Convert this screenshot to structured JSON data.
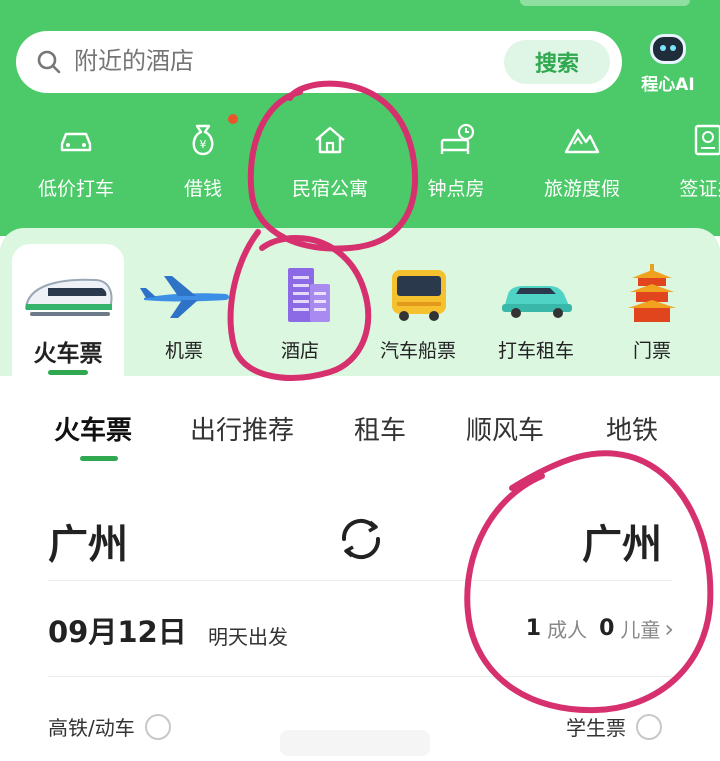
{
  "search": {
    "placeholder": "附近的酒店",
    "button": "搜索"
  },
  "ai": {
    "label": "程心AI"
  },
  "quick_actions": [
    {
      "label": "低价打车",
      "icon": "car-icon"
    },
    {
      "label": "借钱",
      "icon": "money-bag-icon"
    },
    {
      "label": "民宿公寓",
      "icon": "house-icon"
    },
    {
      "label": "钟点房",
      "icon": "hourly-room-icon"
    },
    {
      "label": "旅游度假",
      "icon": "mountain-icon"
    },
    {
      "label": "签证办",
      "icon": "passport-icon"
    }
  ],
  "categories": [
    {
      "label": "火车票",
      "icon": "train-icon",
      "active": true
    },
    {
      "label": "机票",
      "icon": "plane-icon"
    },
    {
      "label": "酒店",
      "icon": "hotel-icon"
    },
    {
      "label": "汽车船票",
      "icon": "bus-icon"
    },
    {
      "label": "打车租车",
      "icon": "taxi-icon"
    },
    {
      "label": "门票",
      "icon": "pagoda-icon"
    }
  ],
  "tabs": [
    {
      "label": "火车票",
      "active": true
    },
    {
      "label": "出行推荐"
    },
    {
      "label": "租车"
    },
    {
      "label": "顺风车"
    },
    {
      "label": "地铁"
    }
  ],
  "trip": {
    "from_city": "广州",
    "to_city": "广州",
    "date": "09月12日",
    "date_note": "明天出发",
    "adults_count": "1",
    "adults_label": "成人",
    "children_count": "0",
    "children_label": "儿童",
    "chevron": "›"
  },
  "options": {
    "high_speed": "高铁/动车",
    "student": "学生票"
  },
  "colors": {
    "brand_green": "#4cc968",
    "accent_green": "#2fa84f",
    "annotation_magenta": "#d6306f"
  }
}
